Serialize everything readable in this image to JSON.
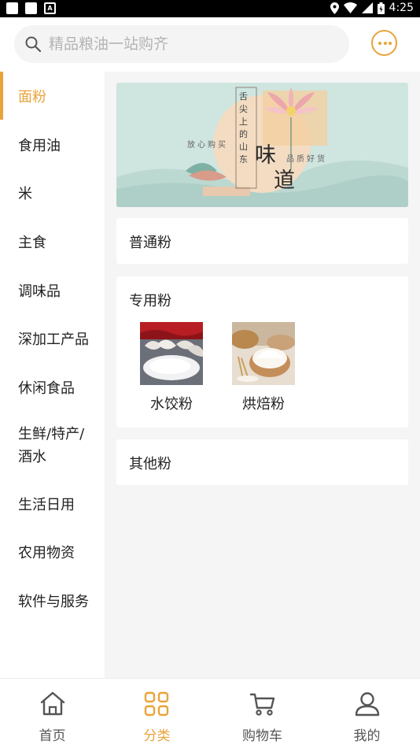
{
  "status_bar": {
    "time": "4:25"
  },
  "search": {
    "placeholder": "精品粮油一站购齐"
  },
  "sidebar": {
    "items": [
      {
        "label": "面粉",
        "active": true
      },
      {
        "label": "食用油"
      },
      {
        "label": "米"
      },
      {
        "label": "主食"
      },
      {
        "label": "调味品"
      },
      {
        "label": "深加工产品"
      },
      {
        "label": "休闲食品"
      },
      {
        "label": "生鲜/特产/酒水"
      },
      {
        "label": "生活日用"
      },
      {
        "label": "农用物资"
      },
      {
        "label": "软件与服务"
      }
    ]
  },
  "banner": {
    "vertical_text": "舌尖上的山东",
    "left_text": "放心购买",
    "main_1": "味",
    "main_2": "道",
    "right_text": "品质好货"
  },
  "sections": [
    {
      "title": "普通粉"
    },
    {
      "title": "专用粉",
      "subcategories": [
        {
          "label": "水饺粉"
        },
        {
          "label": "烘焙粉"
        }
      ]
    },
    {
      "title": "其他粉"
    }
  ],
  "tabbar": {
    "items": [
      {
        "label": "首页",
        "icon": "home-icon"
      },
      {
        "label": "分类",
        "icon": "category-grid-icon",
        "active": true
      },
      {
        "label": "购物车",
        "icon": "cart-icon"
      },
      {
        "label": "我的",
        "icon": "user-icon"
      }
    ]
  },
  "colors": {
    "accent": "#e9a33a",
    "text": "#222222",
    "background": "#f5f5f5"
  }
}
